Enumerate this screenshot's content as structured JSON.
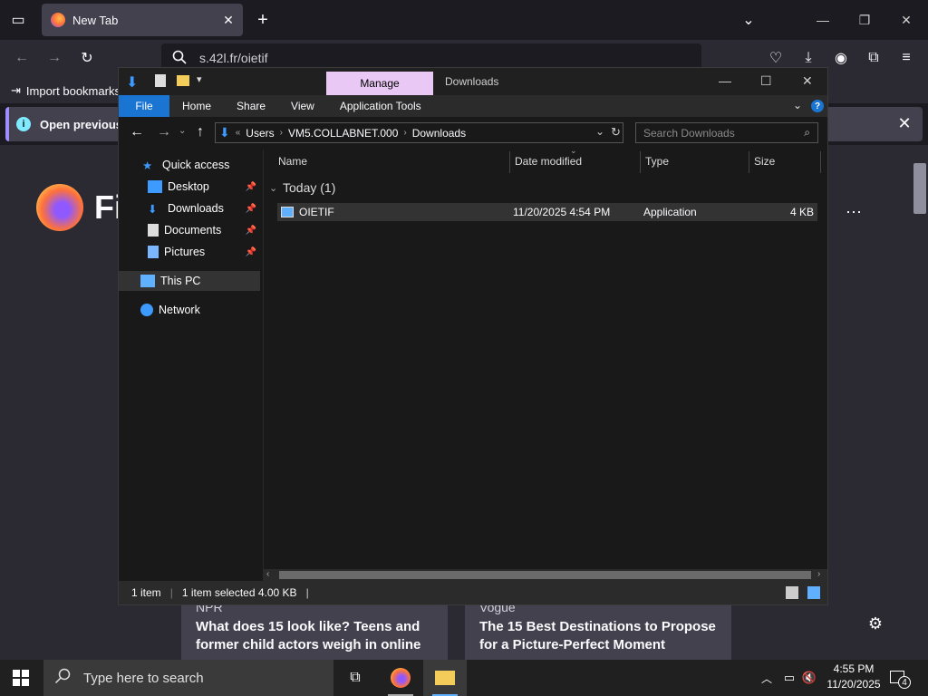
{
  "firefox": {
    "tab_title": "New Tab",
    "url": "s.42l.fr/oietif",
    "bookmarks_item": "Import bookmarks",
    "notice_text": "Open previous ta",
    "logo_text": "Fi",
    "cards": [
      {
        "source": "NPR",
        "headline": "What does 15 look like? Teens and former child actors weigh in online"
      },
      {
        "source": "Vogue",
        "headline": "The 15 Best Destinations to Propose for a Picture-Perfect Moment"
      }
    ]
  },
  "explorer": {
    "manage_tab": "Manage",
    "window_title": "Downloads",
    "ribbon_tabs": [
      "File",
      "Home",
      "Share",
      "View",
      "Application Tools"
    ],
    "breadcrumb": [
      "Users",
      "VM5.COLLABNET.000",
      "Downloads"
    ],
    "search_placeholder": "Search Downloads",
    "nav": {
      "quick_access": "Quick access",
      "desktop": "Desktop",
      "downloads": "Downloads",
      "documents": "Documents",
      "pictures": "Pictures",
      "this_pc": "This PC",
      "network": "Network"
    },
    "columns": [
      "Name",
      "Date modified",
      "Type",
      "Size"
    ],
    "group_header": "Today (1)",
    "files": [
      {
        "name": "OIETIF",
        "date": "11/20/2025 4:54 PM",
        "type": "Application",
        "size": "4 KB"
      }
    ],
    "status": {
      "count": "1 item",
      "selected": "1 item selected  4.00 KB"
    }
  },
  "taskbar": {
    "search_placeholder": "Type here to search",
    "time": "4:55 PM",
    "date": "11/20/2025",
    "notification_count": "4"
  },
  "colors": {
    "accent": "#1a74d2",
    "manage_tab": "#e9c8f5",
    "ff_bg": "#2b2a33"
  }
}
